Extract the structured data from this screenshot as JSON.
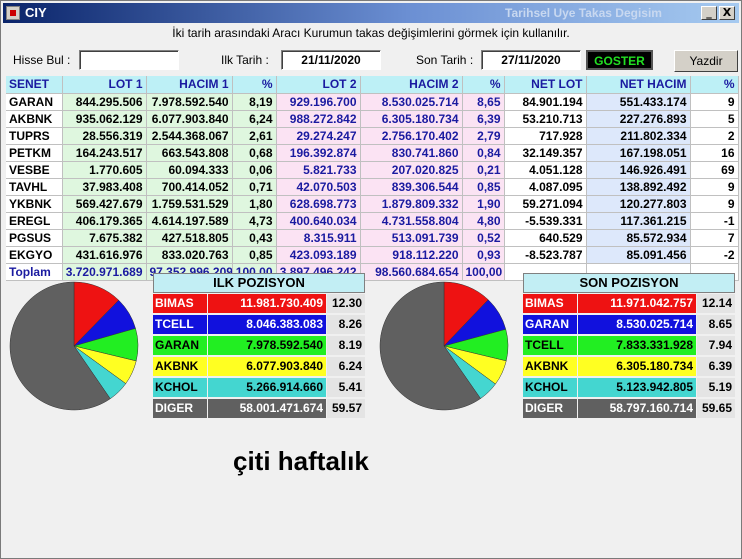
{
  "window": {
    "title": "CIY",
    "subtitle": "Tarihsel Uye Takas Degisim",
    "minimize_label": "_",
    "close_label": "X"
  },
  "info_text": "İki tarih arasındaki  Aracı Kurumun takas değişimlerini görmek için kullanılır.",
  "form": {
    "hisse_label": "Hisse Bul :",
    "hisse_value": "",
    "ilk_tarih_label": "Ilk Tarih :",
    "ilk_tarih_value": "21/11/2020",
    "son_tarih_label": "Son Tarih :",
    "son_tarih_value": "27/11/2020",
    "goster_label": "GOSTER",
    "yazdir_label": "Yazdir"
  },
  "table": {
    "headers": [
      "SENET",
      "LOT 1",
      "HACIM 1",
      "%",
      "LOT 2",
      "HACIM 2",
      "%",
      "NET LOT",
      "NET HACIM",
      "%"
    ],
    "rows": [
      [
        "GARAN",
        "844.295.506",
        "7.978.592.540",
        "8,19",
        "929.196.700",
        "8.530.025.714",
        "8,65",
        "84.901.194",
        "551.433.174",
        "9"
      ],
      [
        "AKBNK",
        "935.062.129",
        "6.077.903.840",
        "6,24",
        "988.272.842",
        "6.305.180.734",
        "6,39",
        "53.210.713",
        "227.276.893",
        "5"
      ],
      [
        "TUPRS",
        "28.556.319",
        "2.544.368.067",
        "2,61",
        "29.274.247",
        "2.756.170.402",
        "2,79",
        "717.928",
        "211.802.334",
        "2"
      ],
      [
        "PETKM",
        "164.243.517",
        "663.543.808",
        "0,68",
        "196.392.874",
        "830.741.860",
        "0,84",
        "32.149.357",
        "167.198.051",
        "16"
      ],
      [
        "VESBE",
        "1.770.605",
        "60.094.333",
        "0,06",
        "5.821.733",
        "207.020.825",
        "0,21",
        "4.051.128",
        "146.926.491",
        "69"
      ],
      [
        "TAVHL",
        "37.983.408",
        "700.414.052",
        "0,71",
        "42.070.503",
        "839.306.544",
        "0,85",
        "4.087.095",
        "138.892.492",
        "9"
      ],
      [
        "YKBNK",
        "569.427.679",
        "1.759.531.529",
        "1,80",
        "628.698.773",
        "1.879.809.332",
        "1,90",
        "59.271.094",
        "120.277.803",
        "9"
      ],
      [
        "EREGL",
        "406.179.365",
        "4.614.197.589",
        "4,73",
        "400.640.034",
        "4.731.558.804",
        "4,80",
        "-5.539.331",
        "117.361.215",
        "-1"
      ],
      [
        "PGSUS",
        "7.675.382",
        "427.518.805",
        "0,43",
        "8.315.911",
        "513.091.739",
        "0,52",
        "640.529",
        "85.572.934",
        "7"
      ],
      [
        "EKGYO",
        "431.616.976",
        "833.020.763",
        "0,85",
        "423.093.189",
        "918.112.220",
        "0,93",
        "-8.523.787",
        "85.091.456",
        "-2"
      ]
    ],
    "total": [
      "Toplam",
      "3.720.971.689",
      "97.352.996.209",
      "100,00",
      "3.897.496.242",
      "98.560.684.654",
      "100,00",
      "",
      "",
      ""
    ]
  },
  "ilk_pozisyon": {
    "title": "ILK POZISYON",
    "rows": [
      {
        "name": "BIMAS",
        "value": "11.981.730.409",
        "pct": "12.30",
        "num": 12.3,
        "color": "#ee1212"
      },
      {
        "name": "TCELL",
        "value": "8.046.383.083",
        "pct": "8.26",
        "num": 8.26,
        "color": "#1111dd"
      },
      {
        "name": "GARAN",
        "value": "7.978.592.540",
        "pct": "8.19",
        "num": 8.19,
        "color": "#22ee22"
      },
      {
        "name": "AKBNK",
        "value": "6.077.903.840",
        "pct": "6.24",
        "num": 6.24,
        "color": "#ffff22"
      },
      {
        "name": "KCHOL",
        "value": "5.266.914.660",
        "pct": "5.41",
        "num": 5.41,
        "color": "#44d6d0"
      },
      {
        "name": "DIGER",
        "value": "58.001.471.674",
        "pct": "59.57",
        "num": 59.57,
        "color": "#606060"
      }
    ]
  },
  "son_pozisyon": {
    "title": "SON POZISYON",
    "rows": [
      {
        "name": "BIMAS",
        "value": "11.971.042.757",
        "pct": "12.14",
        "num": 12.14,
        "color": "#ee1212"
      },
      {
        "name": "GARAN",
        "value": "8.530.025.714",
        "pct": "8.65",
        "num": 8.65,
        "color": "#1111dd"
      },
      {
        "name": "TCELL",
        "value": "7.833.331.928",
        "pct": "7.94",
        "num": 7.94,
        "color": "#22ee22"
      },
      {
        "name": "AKBNK",
        "value": "6.305.180.734",
        "pct": "6.39",
        "num": 6.39,
        "color": "#ffff22"
      },
      {
        "name": "KCHOL",
        "value": "5.123.942.805",
        "pct": "5.19",
        "num": 5.19,
        "color": "#44d6d0"
      },
      {
        "name": "DIGER",
        "value": "58.797.160.714",
        "pct": "59.65",
        "num": 59.65,
        "color": "#606060"
      }
    ]
  },
  "note": "çiti haftalık"
}
